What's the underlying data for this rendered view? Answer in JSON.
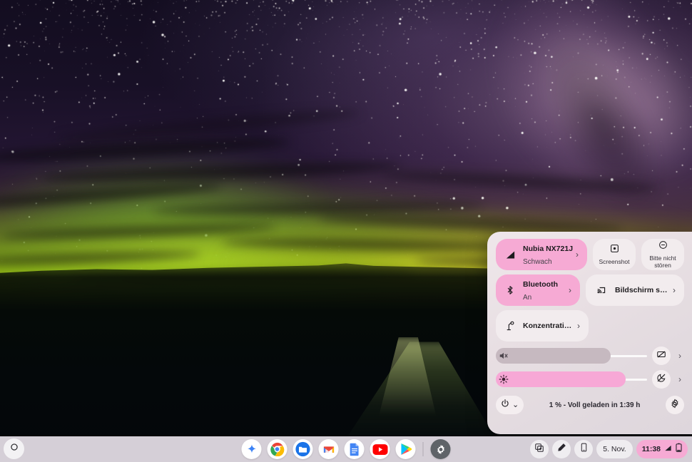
{
  "wallpaper": {
    "name": "aurora-night-sky-wallpaper"
  },
  "quick_settings": {
    "network_tile": {
      "icon": "signal-cellular-icon",
      "title": "Nubia NX721J",
      "subtitle": "Schwach",
      "chevron": "›"
    },
    "screenshot_tile": {
      "icon": "screenshot-icon",
      "label": "Screenshot"
    },
    "dnd_tile": {
      "icon": "do-not-disturb-icon",
      "label": "Bitte nicht stören"
    },
    "bluetooth_tile": {
      "icon": "bluetooth-icon",
      "title": "Bluetooth",
      "subtitle": "An",
      "chevron": "›"
    },
    "cast_tile": {
      "icon": "cast-screen-icon",
      "label": "Bildschirm str...",
      "chevron": "›"
    },
    "focus_tile": {
      "icon": "focus-lamp-icon",
      "label": "Konzentration...",
      "chevron": "›"
    },
    "volume_slider": {
      "icon": "volume-mute-icon",
      "value": 76,
      "aux_icon": "mic-off-icon",
      "chevron": "›"
    },
    "brightness_slider": {
      "icon": "brightness-icon",
      "value": 86,
      "aux_icon": "night-light-off-icon",
      "chevron": "›"
    },
    "power_button": {
      "icon": "power-icon",
      "chevron": "⌄"
    },
    "battery_status": "1 % - Voll geladen in 1:39 h",
    "settings_button": {
      "icon": "gear-icon"
    },
    "colors": {
      "accent_pink": "#f6aad4",
      "panel_bg": "#e8dfe3",
      "tile_grey": "#f2ecee"
    }
  },
  "shelf": {
    "launcher": {
      "icon": "launcher-circle-icon"
    },
    "apps": [
      {
        "name": "gemini",
        "label": "Gemini"
      },
      {
        "name": "chrome",
        "label": "Google Chrome"
      },
      {
        "name": "files",
        "label": "Dateien"
      },
      {
        "name": "gmail",
        "label": "Gmail"
      },
      {
        "name": "docs",
        "label": "Google Docs"
      },
      {
        "name": "youtube",
        "label": "YouTube"
      },
      {
        "name": "play-store",
        "label": "Play Store"
      },
      {
        "name": "settings",
        "label": "Einstellungen"
      }
    ],
    "status": {
      "screen_capture": {
        "icon": "screen-capture-icon"
      },
      "stylus": {
        "icon": "stylus-pen-icon"
      },
      "phone_hub": {
        "icon": "phone-icon"
      },
      "date": "5. Nov.",
      "time": "11:38",
      "signal_icon": "signal-cellular-icon",
      "battery_icon": "battery-low-icon"
    }
  }
}
